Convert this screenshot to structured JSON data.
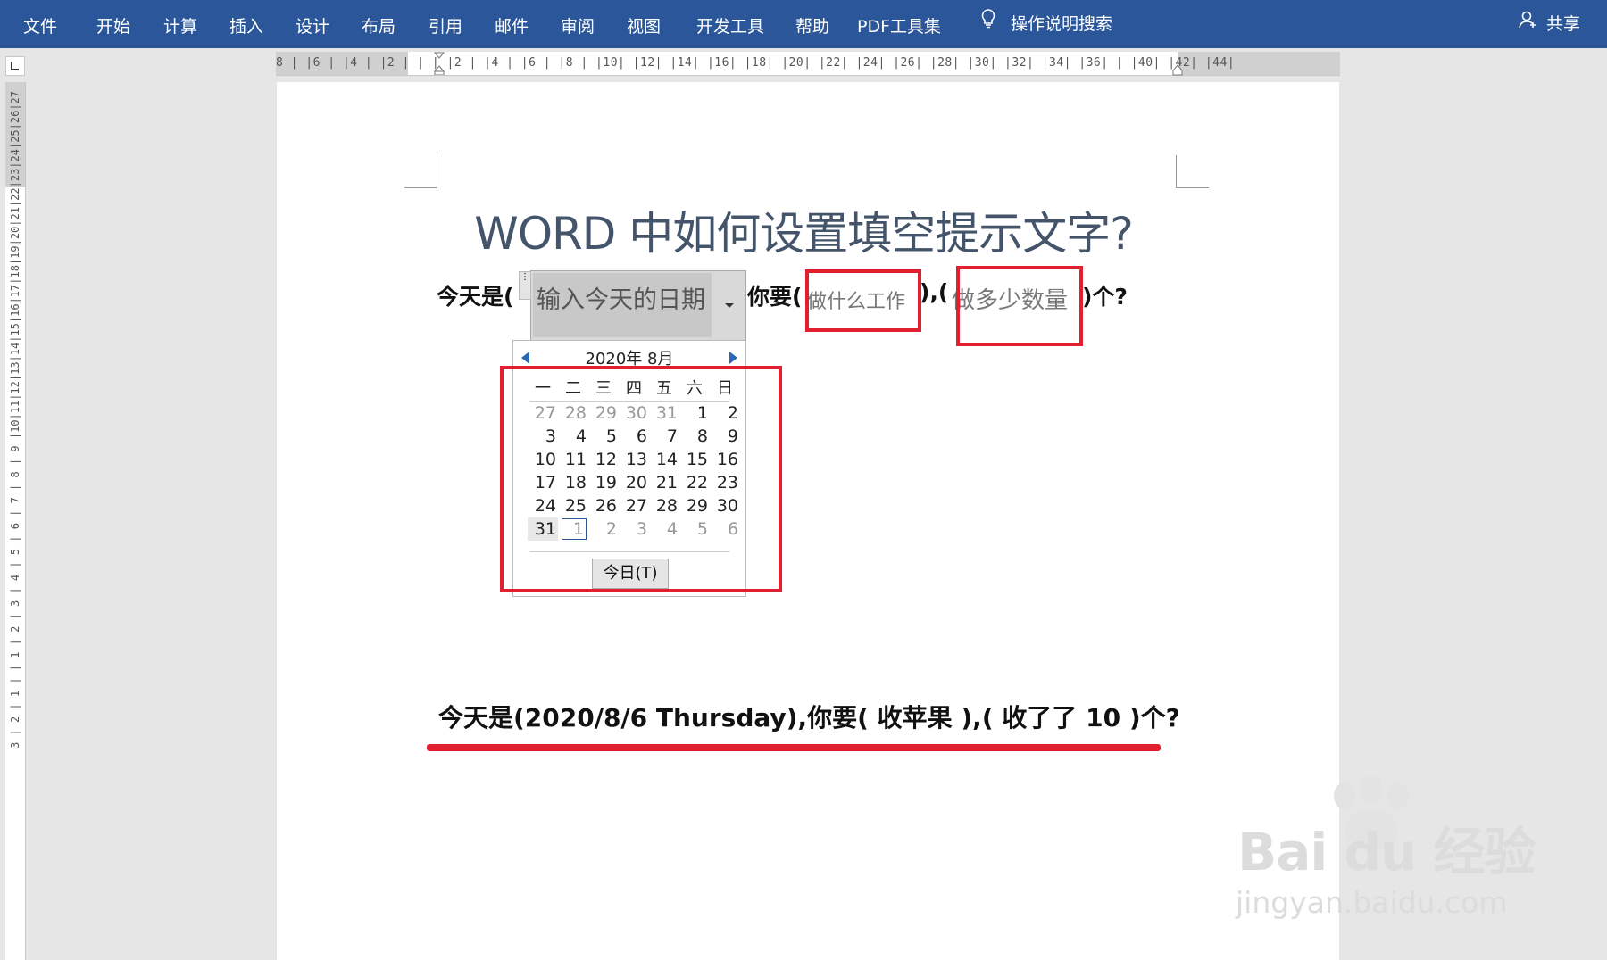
{
  "ribbon": {
    "tabs": [
      "文件",
      "开始",
      "计算",
      "插入",
      "设计",
      "布局",
      "引用",
      "邮件",
      "审阅",
      "视图",
      "开发工具",
      "帮助",
      "PDF工具集"
    ],
    "tell_me": "操作说明搜索",
    "share": "共享",
    "color": "#2b579a"
  },
  "ruler": {
    "horizontal": "8 | |6 | |4 | |2 | |   | |2 | |4 | |6 | |8 | |10| |12| |14| |16| |18| |20| |22| |24| |26| |28| |30| |32| |34| |36| |   |40| |42| |44|",
    "vertical": "3 | 2 | 1 |   | 1 | 2 | 3 | 4 | 5 | 6 | 7 | 8 | 9 |10|11|12|13|14|15|16|17|18|19|20|21|22|23|24|25|26|27"
  },
  "document": {
    "title": "WORD 中如何设置填空提示文字?",
    "line1": {
      "prefix": "今天是(",
      "date_placeholder": "输入今天的日期",
      "middle": "你要(",
      "work_placeholder": "做什么工作",
      "sep": "),(",
      "qty_placeholder": "做多少数量",
      "suffix": ")个?"
    },
    "line2": "今天是(2020/8/6 Thursday),你要(  收苹果  ),(  收了了 10  )个?"
  },
  "calendar": {
    "month_title": "2020年 8月",
    "weekdays": [
      "一",
      "二",
      "三",
      "四",
      "五",
      "六",
      "日"
    ],
    "weeks": [
      [
        {
          "d": "27",
          "o": true
        },
        {
          "d": "28",
          "o": true
        },
        {
          "d": "29",
          "o": true
        },
        {
          "d": "30",
          "o": true
        },
        {
          "d": "31",
          "o": true
        },
        {
          "d": "1"
        },
        {
          "d": "2"
        }
      ],
      [
        {
          "d": "3"
        },
        {
          "d": "4"
        },
        {
          "d": "5"
        },
        {
          "d": "6"
        },
        {
          "d": "7"
        },
        {
          "d": "8"
        },
        {
          "d": "9"
        }
      ],
      [
        {
          "d": "10"
        },
        {
          "d": "11"
        },
        {
          "d": "12"
        },
        {
          "d": "13"
        },
        {
          "d": "14"
        },
        {
          "d": "15"
        },
        {
          "d": "16"
        }
      ],
      [
        {
          "d": "17"
        },
        {
          "d": "18"
        },
        {
          "d": "19"
        },
        {
          "d": "20"
        },
        {
          "d": "21"
        },
        {
          "d": "22"
        },
        {
          "d": "23"
        }
      ],
      [
        {
          "d": "24"
        },
        {
          "d": "25"
        },
        {
          "d": "26"
        },
        {
          "d": "27"
        },
        {
          "d": "28"
        },
        {
          "d": "29"
        },
        {
          "d": "30"
        }
      ],
      [
        {
          "d": "31",
          "sel": true
        },
        {
          "d": "1",
          "o": true,
          "focus": true
        },
        {
          "d": "2",
          "o": true
        },
        {
          "d": "3",
          "o": true
        },
        {
          "d": "4",
          "o": true
        },
        {
          "d": "5",
          "o": true
        },
        {
          "d": "6",
          "o": true
        }
      ]
    ],
    "today_button": "今日(T)"
  },
  "watermark": {
    "brand": "Bai du 经验",
    "url": "jingyan.baidu.com"
  },
  "accent_color": "#e0202e"
}
